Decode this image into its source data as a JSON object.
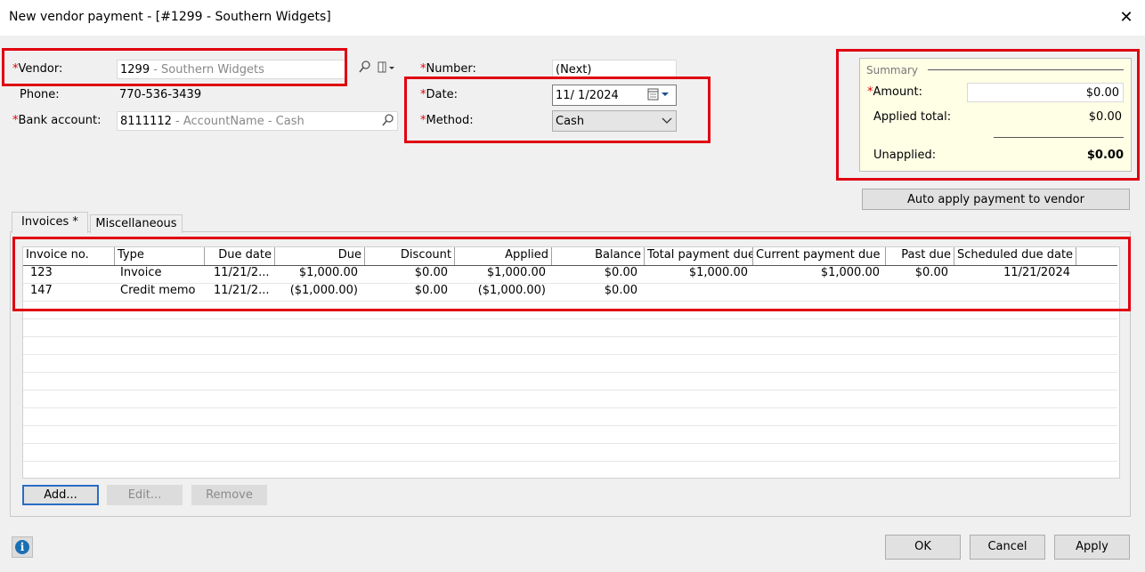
{
  "window": {
    "title": "New vendor payment - [#1299 - Southern Widgets]",
    "close_glyph": "✕"
  },
  "form": {
    "vendor": {
      "label": "Vendor:",
      "code": "1299",
      "name": " - Southern Widgets"
    },
    "phone": {
      "label": "Phone:",
      "value": "770-536-3439"
    },
    "bank_account": {
      "label": "Bank account:",
      "code": "8111112",
      "name": " - AccountName - Cash"
    },
    "number": {
      "label": "Number:",
      "value": "(Next)"
    },
    "date": {
      "label": "Date:",
      "value": "11/  1/2024"
    },
    "method": {
      "label": "Method:",
      "value": "Cash"
    },
    "required_mark": "*"
  },
  "summary": {
    "title": "Summary",
    "amount_label": "Amount:",
    "amount_value": "$0.00",
    "applied_total_label": "Applied total:",
    "applied_total_value": "$0.00",
    "unapplied_label": "Unapplied:",
    "unapplied_value": "$0.00",
    "auto_apply_label": "Auto apply payment to vendor"
  },
  "tabs": [
    {
      "label": "Invoices *",
      "active": true
    },
    {
      "label": "Miscellaneous",
      "active": false
    }
  ],
  "table": {
    "columns": [
      "Invoice no.",
      "Type",
      "Due date",
      "Due",
      "Discount",
      "Applied",
      "Balance",
      "Total payment due",
      "Current payment due",
      "Past due",
      "Scheduled due date"
    ],
    "rows": [
      [
        "123",
        "Invoice",
        "11/21/2...",
        "$1,000.00",
        "$0.00",
        "$1,000.00",
        "$0.00",
        "$1,000.00",
        "$1,000.00",
        "$0.00",
        "11/21/2024"
      ],
      [
        "147",
        "Credit memo",
        "11/21/2...",
        "($1,000.00)",
        "$0.00",
        "($1,000.00)",
        "$0.00",
        "",
        "",
        "",
        ""
      ]
    ]
  },
  "grid_buttons": {
    "add": "Add...",
    "edit": "Edit...",
    "remove": "Remove"
  },
  "footer": {
    "ok": "OK",
    "cancel": "Cancel",
    "apply": "Apply",
    "info_glyph": "i"
  },
  "colors": {
    "highlight": "#e00010",
    "required": "#e00000",
    "summary_bg": "#ffffe6",
    "info_icon": "#1a6fb3"
  }
}
